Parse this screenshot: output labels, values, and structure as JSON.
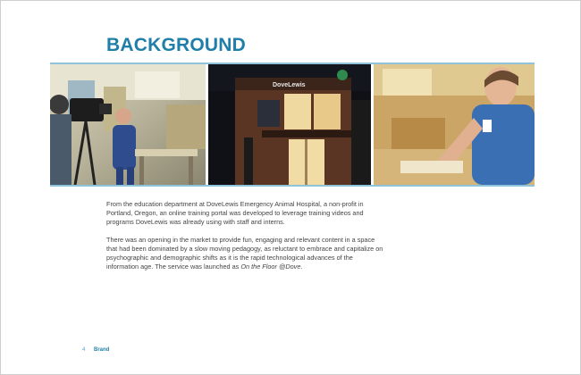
{
  "page": {
    "title": "BACKGROUND",
    "accent_color": "#1f7fa8",
    "paragraphs": {
      "p1": "From the education department at DoveLewis Emergency Animal Hospital, a non-profit in Portland, Oregon, an online training portal was developed to leverage training videos and programs DoveLewis was already using with staff and interns.",
      "p2_main": "There was an opening in the market to provide fun, engaging and relevant content in a space that had been dominated by a slow moving pedagogy, as reluctant to embrace and capitalize on psychographic and demographic shifts as it is the rapid technological advances of the information age. The service was launched as ",
      "p2_italic": "On the Floor @Dove",
      "p2_end": "."
    },
    "photos": {
      "sign_text": "DoveLewis"
    },
    "footer": {
      "page_number": "4",
      "section": "Brand"
    }
  }
}
